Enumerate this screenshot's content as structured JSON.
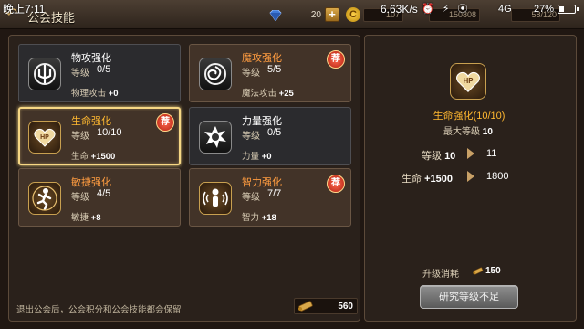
{
  "status_bar": {
    "time": "晚上7:11",
    "network_speed": "6.63K/s",
    "network_type": "4G",
    "battery": "27%",
    "battery_level": 0.27
  },
  "header": {
    "title": "公会技能",
    "gems": "20",
    "res_one": "107",
    "res_two": "150808",
    "res_three": "58/120"
  },
  "skills": [
    {
      "name": "物攻强化",
      "level_label": "等级",
      "level": "0/5",
      "effect_label": "物理攻击",
      "effect_value": "+0",
      "recommended": false,
      "unlocked": false,
      "selected": false,
      "icon": "sword-trident-icon"
    },
    {
      "name": "魔攻强化",
      "level_label": "等级",
      "level": "5/5",
      "effect_label": "魔法攻击",
      "effect_value": "+25",
      "recommended": true,
      "badge": "荐",
      "unlocked": true,
      "selected": false,
      "icon": "magic-swirl-icon"
    },
    {
      "name": "生命强化",
      "level_label": "等级",
      "level": "10/10",
      "effect_label": "生命",
      "effect_value": "+1500",
      "recommended": true,
      "badge": "荐",
      "unlocked": true,
      "selected": true,
      "icon": "hp-heart-icon"
    },
    {
      "name": "力量强化",
      "level_label": "等级",
      "level": "0/5",
      "effect_label": "力量",
      "effect_value": "+0",
      "recommended": false,
      "unlocked": false,
      "selected": false,
      "icon": "fist-burst-icon"
    },
    {
      "name": "敏捷强化",
      "level_label": "等级",
      "level": "4/5",
      "effect_label": "敏捷",
      "effect_value": "+8",
      "recommended": false,
      "unlocked": true,
      "selected": false,
      "icon": "running-man-icon"
    },
    {
      "name": "智力强化",
      "level_label": "等级",
      "level": "7/7",
      "effect_label": "智力",
      "effect_value": "+18",
      "recommended": true,
      "badge": "荐",
      "unlocked": true,
      "selected": false,
      "icon": "wisdom-figure-icon"
    }
  ],
  "footer": {
    "note": "退出公会后，公会积分和公会技能都会保留",
    "points": "560"
  },
  "detail": {
    "title": "生命强化(10/10)",
    "max_level_label": "最大等级",
    "max_level": "10",
    "level_label": "等级",
    "level_current": "10",
    "level_next": "11",
    "stat_label": "生命",
    "stat_current": "+1500",
    "stat_next": "1800",
    "cost_label": "升级消耗",
    "cost_value": "150",
    "button_label": "研究等级不足"
  },
  "colors": {
    "accent_gold": "#ffb830",
    "selected_border": "#f6d784",
    "badge_red": "#d23a24",
    "panel_bg": "#2a211b"
  }
}
